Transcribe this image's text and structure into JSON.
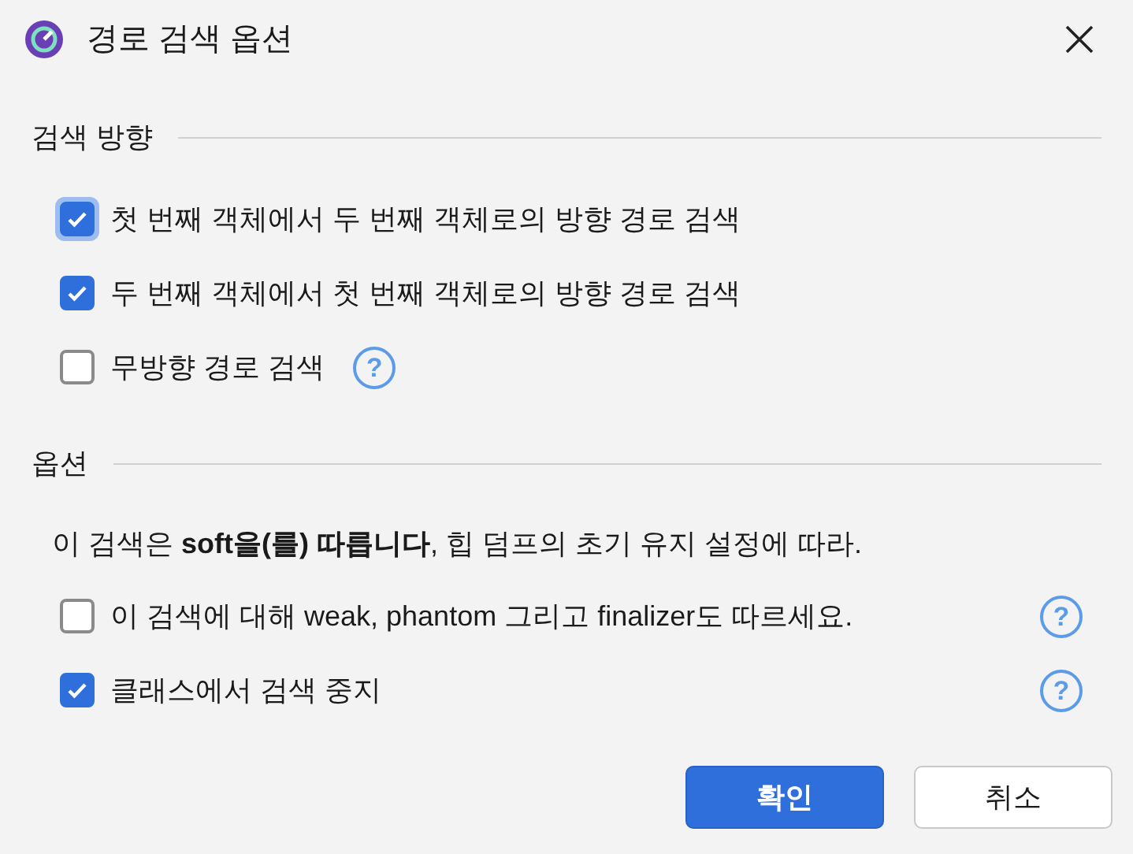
{
  "window": {
    "title": "경로 검색 옵션"
  },
  "sections": [
    {
      "label": "검색 방향",
      "items": [
        {
          "label": "첫 번째 객체에서 두 번째 객체로의 방향 경로 검색",
          "checked": true,
          "focused": true
        },
        {
          "label": "두 번째 객체에서 첫 번째 객체로의 방향 경로 검색",
          "checked": true,
          "focused": false
        },
        {
          "label": "무방향 경로 검색",
          "checked": false,
          "focused": false,
          "help": "?"
        }
      ]
    },
    {
      "label": "옵션",
      "description": "이 검색은 **soft을(를) 따릅니다**, 힙 덤프의 초기 유지 설정에 따라.",
      "items": [
        {
          "label": "이 검색에 대해 weak, phantom 그리고 finalizer도 따르세요.",
          "checked": false,
          "focused": false,
          "help": "?"
        },
        {
          "label": "클래스에서 검색 중지",
          "checked": true,
          "focused": false,
          "help": "?"
        }
      ]
    }
  ],
  "buttons": [
    {
      "label": "확인",
      "kind": "primary"
    },
    {
      "label": "취소",
      "kind": "secondary"
    }
  ]
}
